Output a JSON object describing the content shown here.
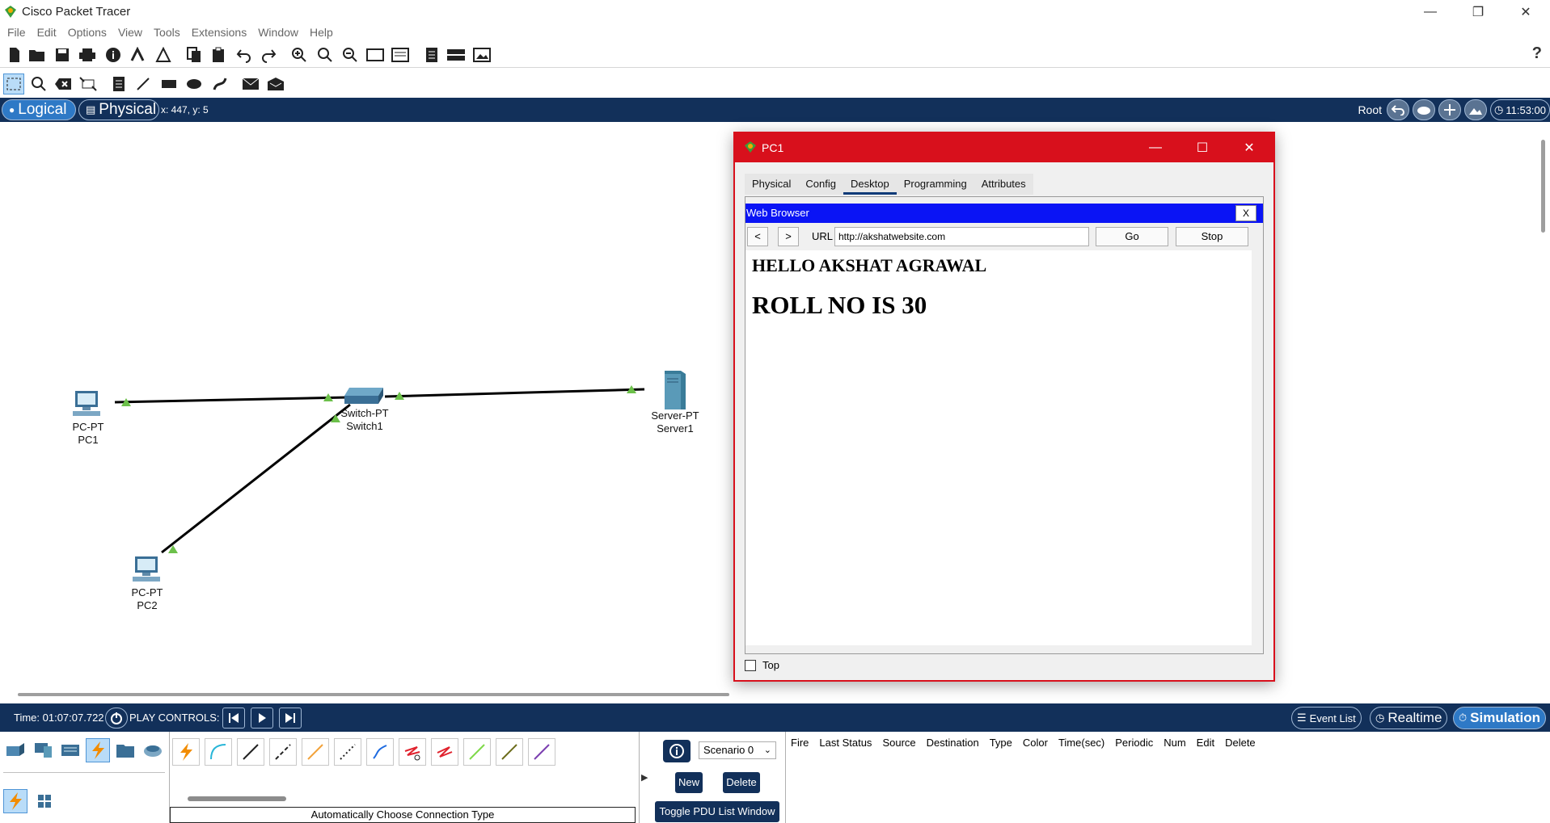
{
  "window": {
    "title": "Cisco Packet Tracer"
  },
  "menu": [
    "File",
    "Edit",
    "Options",
    "View",
    "Tools",
    "Extensions",
    "Window",
    "Help"
  ],
  "toolbar": {
    "help_label": "?"
  },
  "modebar": {
    "logical_label": "Logical",
    "physical_label": "Physical",
    "coords": "x: 447, y: 5",
    "root_label": "Root",
    "clock": "11:53:00"
  },
  "devices": [
    {
      "type": "PC-PT",
      "name": "PC1"
    },
    {
      "type": "PC-PT",
      "name": "PC2"
    },
    {
      "type": "Switch-PT",
      "name": "Switch1"
    },
    {
      "type": "Server-PT",
      "name": "Server1"
    }
  ],
  "pc_window": {
    "title": "PC1",
    "tabs": [
      "Physical",
      "Config",
      "Desktop",
      "Programming",
      "Attributes"
    ],
    "active_tab": "Desktop",
    "browser": {
      "title": "Web Browser",
      "close_label": "X",
      "back_label": "<",
      "forward_label": ">",
      "url_label": "URL",
      "url": "http://akshatwebsite.com",
      "go_label": "Go",
      "stop_label": "Stop",
      "heading1": "HELLO AKSHAT AGRAWAL",
      "heading2": "ROLL NO IS 30"
    },
    "top_checkbox_label": "Top",
    "top_checked": false
  },
  "simbar": {
    "time": "Time: 01:07:07.722",
    "play_controls": "PLAY CONTROLS:",
    "event_list": "Event List",
    "realtime": "Realtime",
    "simulation": "Simulation"
  },
  "bottom": {
    "connection_hint": "Automatically Choose Connection Type",
    "scenario": "Scenario 0",
    "new_label": "New",
    "delete_label": "Delete",
    "toggle_label": "Toggle PDU List Window",
    "pdu_columns": [
      "Fire",
      "Last Status",
      "Source",
      "Destination",
      "Type",
      "Color",
      "Time(sec)",
      "Periodic",
      "Num",
      "Edit",
      "Delete"
    ]
  },
  "colors": {
    "accent": "#12305a",
    "window_red": "#d8101c",
    "browser_blue": "#0a14f5",
    "link_green": "#6cc04a"
  }
}
